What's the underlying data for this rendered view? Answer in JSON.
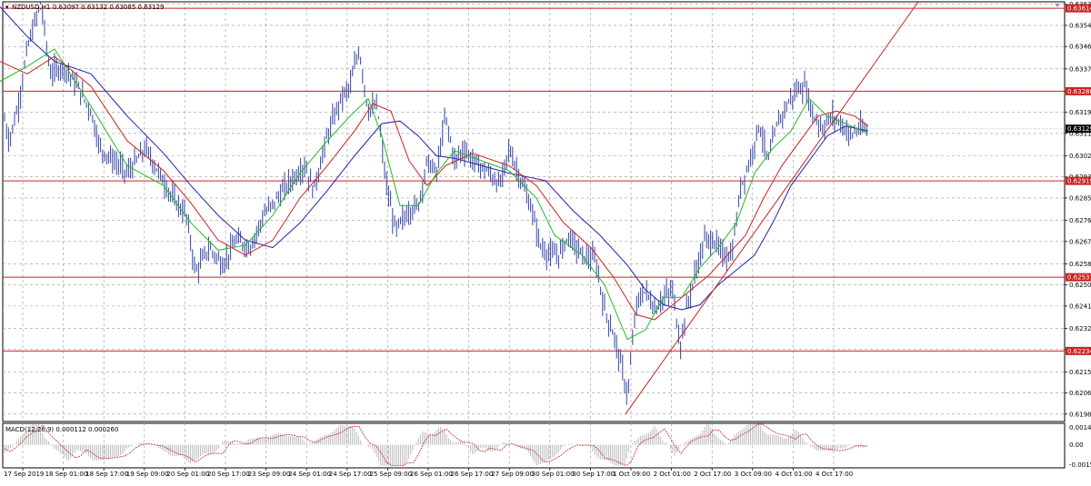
{
  "header": {
    "symbol_label": "NZDUSD,H1",
    "ohlc_values": "0.63097 0.63132 0.63085 0.63129"
  },
  "macd_panel": {
    "label": "MACD(12,26,9) 0.000112 0.000260"
  },
  "colors": {
    "background": "#ffffff",
    "candle": "#3344aa",
    "ma_fast": "#22bb22",
    "ma_mid": "#cc2222",
    "ma_slow": "#2222aa",
    "level_line": "#cc2222",
    "trend_line": "#cc2222",
    "grid": "#999999",
    "macd_hist": "#bbbbbb",
    "macd_signal": "#cc2222"
  },
  "chart_data": {
    "type": "line",
    "title": "NZDUSD,H1",
    "price_scale": {
      "min": 0.6195,
      "max": 0.6364,
      "ticks": [
        "0.63630",
        "0.63545",
        "0.63460",
        "0.63370",
        "0.63280",
        "0.63195",
        "0.63110",
        "0.63020",
        "0.62935",
        "0.62850",
        "0.62760",
        "0.62675",
        "0.62585",
        "0.62500",
        "0.62415",
        "0.62325",
        "0.62240",
        "0.62150",
        "0.62065",
        "0.61980"
      ]
    },
    "current_price": "0.63129",
    "levels": [
      {
        "name": "level-1",
        "price": 0.63614,
        "label": "0.63614"
      },
      {
        "name": "level-2",
        "price": 0.6328,
        "label": "0.63280"
      },
      {
        "name": "level-3",
        "price": 0.62919,
        "label": "0.62919"
      },
      {
        "name": "level-4",
        "price": 0.62531,
        "label": "0.62531"
      },
      {
        "name": "level-5",
        "price": 0.62234,
        "label": "0.62234"
      }
    ],
    "time_labels": [
      "17 Sep 2019",
      "18 Sep 01:00",
      "18 Sep 17:00",
      "19 Sep 09:00",
      "20 Sep 01:00",
      "20 Sep 17:00",
      "23 Sep 09:00",
      "24 Sep 01:00",
      "24 Sep 17:00",
      "25 Sep 09:00",
      "26 Sep 01:00",
      "26 Sep 17:00",
      "27 Sep 09:00",
      "30 Sep 01:00",
      "30 Sep 17:00",
      "1 Oct 09:00",
      "2 Oct 01:00",
      "2 Oct 17:00",
      "3 Oct 09:00",
      "4 Oct 01:00",
      "4 Oct 17:00"
    ],
    "price_path": [
      [
        0,
        0.6325
      ],
      [
        10,
        0.6308
      ],
      [
        20,
        0.6322
      ],
      [
        30,
        0.6345
      ],
      [
        45,
        0.6364
      ],
      [
        55,
        0.6335
      ],
      [
        70,
        0.6338
      ],
      [
        85,
        0.633
      ],
      [
        100,
        0.632
      ],
      [
        110,
        0.6305
      ],
      [
        125,
        0.63
      ],
      [
        140,
        0.6295
      ],
      [
        160,
        0.6305
      ],
      [
        175,
        0.6295
      ],
      [
        190,
        0.6285
      ],
      [
        205,
        0.6278
      ],
      [
        215,
        0.6255
      ],
      [
        230,
        0.6265
      ],
      [
        245,
        0.6258
      ],
      [
        260,
        0.6268
      ],
      [
        275,
        0.6265
      ],
      [
        290,
        0.6278
      ],
      [
        305,
        0.6285
      ],
      [
        320,
        0.6292
      ],
      [
        335,
        0.6298
      ],
      [
        345,
        0.6288
      ],
      [
        360,
        0.631
      ],
      [
        375,
        0.6325
      ],
      [
        385,
        0.633
      ],
      [
        395,
        0.6345
      ],
      [
        405,
        0.632
      ],
      [
        415,
        0.6322
      ],
      [
        425,
        0.629
      ],
      [
        435,
        0.6272
      ],
      [
        450,
        0.628
      ],
      [
        460,
        0.6282
      ],
      [
        470,
        0.63
      ],
      [
        480,
        0.6295
      ],
      [
        490,
        0.6318
      ],
      [
        500,
        0.63
      ],
      [
        510,
        0.6305
      ],
      [
        520,
        0.63
      ],
      [
        535,
        0.6296
      ],
      [
        550,
        0.629
      ],
      [
        560,
        0.6305
      ],
      [
        570,
        0.6295
      ],
      [
        585,
        0.628
      ],
      [
        595,
        0.6265
      ],
      [
        605,
        0.6262
      ],
      [
        615,
        0.6262
      ],
      [
        625,
        0.627
      ],
      [
        640,
        0.6262
      ],
      [
        655,
        0.626
      ],
      [
        665,
        0.624
      ],
      [
        675,
        0.623
      ],
      [
        685,
        0.6215
      ],
      [
        690,
        0.6205
      ],
      [
        700,
        0.6242
      ],
      [
        710,
        0.6248
      ],
      [
        720,
        0.624
      ],
      [
        730,
        0.6245
      ],
      [
        740,
        0.6248
      ],
      [
        748,
        0.6225
      ],
      [
        755,
        0.624
      ],
      [
        765,
        0.6255
      ],
      [
        775,
        0.6268
      ],
      [
        785,
        0.6268
      ],
      [
        795,
        0.6262
      ],
      [
        805,
        0.6262
      ],
      [
        815,
        0.629
      ],
      [
        825,
        0.63
      ],
      [
        835,
        0.6315
      ],
      [
        845,
        0.63
      ],
      [
        855,
        0.6315
      ],
      [
        865,
        0.6322
      ],
      [
        875,
        0.6328
      ],
      [
        885,
        0.633
      ],
      [
        895,
        0.6318
      ],
      [
        905,
        0.6313
      ],
      [
        915,
        0.6318
      ],
      [
        925,
        0.6315
      ],
      [
        935,
        0.631
      ],
      [
        945,
        0.6313
      ],
      [
        955,
        0.6312
      ]
    ],
    "ma_fast_path": [
      [
        0,
        0.6332
      ],
      [
        30,
        0.6338
      ],
      [
        60,
        0.6345
      ],
      [
        100,
        0.6322
      ],
      [
        140,
        0.6298
      ],
      [
        180,
        0.629
      ],
      [
        210,
        0.6275
      ],
      [
        240,
        0.6264
      ],
      [
        270,
        0.6266
      ],
      [
        300,
        0.6278
      ],
      [
        330,
        0.6295
      ],
      [
        360,
        0.6308
      ],
      [
        385,
        0.6318
      ],
      [
        405,
        0.6325
      ],
      [
        420,
        0.631
      ],
      [
        440,
        0.6282
      ],
      [
        460,
        0.6282
      ],
      [
        480,
        0.6295
      ],
      [
        500,
        0.6304
      ],
      [
        530,
        0.63
      ],
      [
        560,
        0.6296
      ],
      [
        590,
        0.6285
      ],
      [
        610,
        0.627
      ],
      [
        640,
        0.6262
      ],
      [
        665,
        0.625
      ],
      [
        690,
        0.6228
      ],
      [
        710,
        0.6232
      ],
      [
        730,
        0.6245
      ],
      [
        750,
        0.6245
      ],
      [
        770,
        0.6257
      ],
      [
        790,
        0.6265
      ],
      [
        810,
        0.6275
      ],
      [
        830,
        0.6295
      ],
      [
        850,
        0.6305
      ],
      [
        870,
        0.6312
      ],
      [
        890,
        0.6325
      ],
      [
        910,
        0.6318
      ],
      [
        930,
        0.6315
      ],
      [
        955,
        0.6311
      ]
    ],
    "ma_mid_path": [
      [
        0,
        0.634
      ],
      [
        30,
        0.6335
      ],
      [
        60,
        0.6342
      ],
      [
        100,
        0.633
      ],
      [
        140,
        0.6308
      ],
      [
        180,
        0.6296
      ],
      [
        210,
        0.6283
      ],
      [
        240,
        0.6268
      ],
      [
        270,
        0.6262
      ],
      [
        300,
        0.6268
      ],
      [
        330,
        0.6285
      ],
      [
        360,
        0.6298
      ],
      [
        390,
        0.6312
      ],
      [
        410,
        0.6323
      ],
      [
        430,
        0.632
      ],
      [
        450,
        0.63
      ],
      [
        470,
        0.629
      ],
      [
        490,
        0.6298
      ],
      [
        520,
        0.6303
      ],
      [
        560,
        0.6298
      ],
      [
        590,
        0.629
      ],
      [
        620,
        0.6275
      ],
      [
        650,
        0.6265
      ],
      [
        675,
        0.6253
      ],
      [
        700,
        0.6238
      ],
      [
        720,
        0.6236
      ],
      [
        740,
        0.6242
      ],
      [
        760,
        0.6248
      ],
      [
        780,
        0.6254
      ],
      [
        800,
        0.6262
      ],
      [
        820,
        0.627
      ],
      [
        840,
        0.6285
      ],
      [
        860,
        0.6298
      ],
      [
        880,
        0.6308
      ],
      [
        900,
        0.6318
      ],
      [
        920,
        0.632
      ],
      [
        940,
        0.6318
      ],
      [
        955,
        0.6314
      ]
    ],
    "ma_slow_path": [
      [
        0,
        0.6362
      ],
      [
        30,
        0.635
      ],
      [
        60,
        0.634
      ],
      [
        100,
        0.6335
      ],
      [
        140,
        0.6318
      ],
      [
        180,
        0.6303
      ],
      [
        210,
        0.629
      ],
      [
        240,
        0.6278
      ],
      [
        270,
        0.6268
      ],
      [
        300,
        0.6265
      ],
      [
        330,
        0.6275
      ],
      [
        360,
        0.6288
      ],
      [
        390,
        0.6302
      ],
      [
        420,
        0.6315
      ],
      [
        440,
        0.6316
      ],
      [
        460,
        0.631
      ],
      [
        480,
        0.6302
      ],
      [
        500,
        0.6301
      ],
      [
        530,
        0.6298
      ],
      [
        560,
        0.6295
      ],
      [
        600,
        0.6292
      ],
      [
        630,
        0.628
      ],
      [
        660,
        0.627
      ],
      [
        690,
        0.6258
      ],
      [
        710,
        0.6248
      ],
      [
        730,
        0.6242
      ],
      [
        750,
        0.624
      ],
      [
        770,
        0.6242
      ],
      [
        790,
        0.625
      ],
      [
        810,
        0.6256
      ],
      [
        830,
        0.6262
      ],
      [
        850,
        0.6275
      ],
      [
        870,
        0.629
      ],
      [
        890,
        0.63
      ],
      [
        910,
        0.631
      ],
      [
        930,
        0.6314
      ],
      [
        955,
        0.6312
      ]
    ],
    "trend_line": [
      [
        688,
        0.6198
      ],
      [
        1010,
        0.6368
      ]
    ],
    "macd": {
      "label": "MACD(12,26,9) 0.000112 0.000260",
      "scale_ticks": [
        "0.001477",
        "0.00",
        "-0.00159"
      ]
    }
  }
}
